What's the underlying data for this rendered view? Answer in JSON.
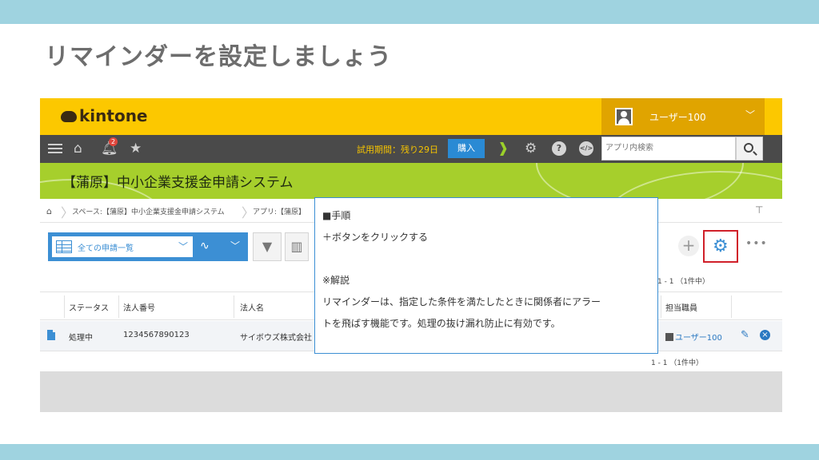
{
  "slide": {
    "title": "リマインダーを設定しましょう"
  },
  "kintone": {
    "logo_text": "kintone",
    "user_name": "ユーザー100",
    "notification_count": "2",
    "trial_text": "試用期間：残り29日",
    "buy_label": "購入",
    "search_placeholder": "アプリ内検索",
    "app_title": "【蒲原】中小企業支援金申請システム",
    "breadcrumb": [
      "スペース:【蒲原】中小企業支援金申請システム",
      "アプリ:【蒲原】"
    ],
    "view_name": "全ての申請一覧",
    "count_top": "1 - 1 （1件中）",
    "count_bottom": "1 - 1 （1件中）",
    "columns": [
      "ステータス",
      "法人番号",
      "法人名",
      "担当職員"
    ],
    "rows": [
      {
        "status": "処理中",
        "corp_number": "1234567890123",
        "corp_name": "サイボウズ株式会社",
        "staff": "ユーザー100"
      }
    ]
  },
  "callout": {
    "lines": [
      "■手順",
      "＋ボタンをクリックする",
      "",
      "※解説",
      "リマインダーは、指定した条件を満たしたときに関係者にアラー",
      "トを飛ばす機能です。処理の抜け漏れ防止に有効です。"
    ]
  },
  "colors": {
    "band": "#9fd3e0",
    "header_yellow": "#fcc800",
    "app_green": "#a6cf2c",
    "accent_blue": "#3c8fd4",
    "highlight_red": "#d0202a"
  },
  "icons": [
    "hamburger-icon",
    "home-icon",
    "bell-icon",
    "star-icon",
    "beginner-icon",
    "gear-icon",
    "help-icon",
    "api-icon",
    "search-icon",
    "pin-icon",
    "filter-icon",
    "graph-icon",
    "add-icon",
    "more-icon",
    "document-icon",
    "edit-icon",
    "delete-icon"
  ]
}
